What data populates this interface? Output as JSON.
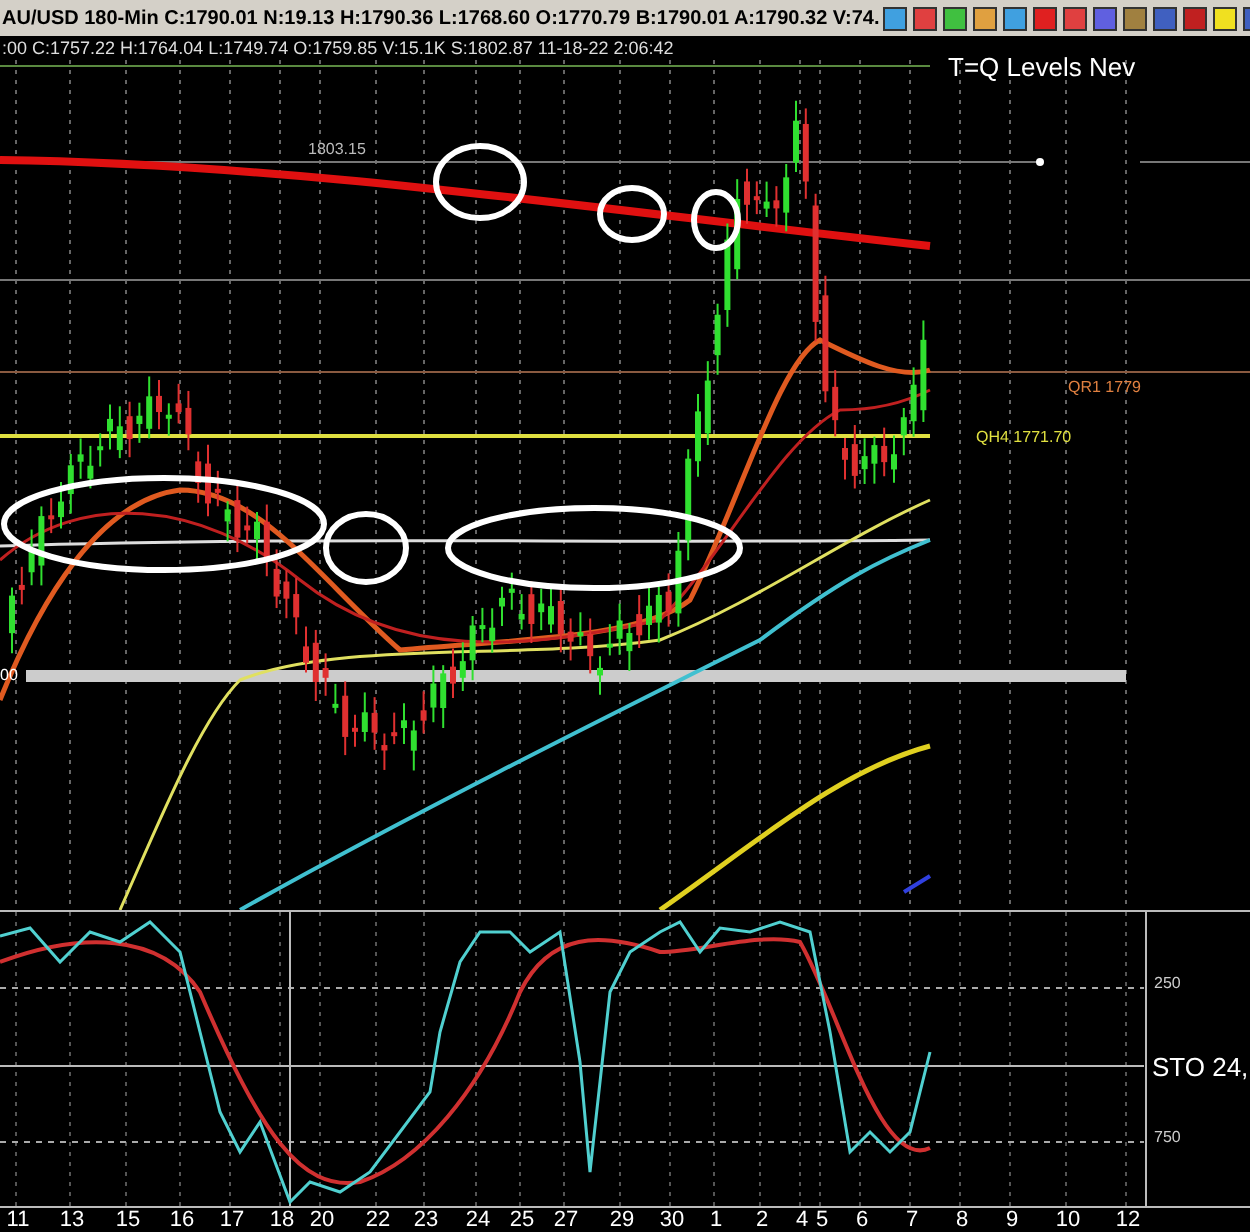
{
  "header": {
    "quote_line": "AU/USD  180-Min  C:1790.01  N:19.13  H:1790.36  L:1768.60  O:1770.79  B:1790.01  A:1790.32  V:74.",
    "bar_line": ":00  C:1757.22  H:1764.04  L:1749.74  O:1759.85  V:15.1K  S:1802.87  11-18-22  2:06:42"
  },
  "chart": {
    "title": "T=Q Levels Nev",
    "level_labels": [
      "1803.15",
      "QR1 1779",
      "QH4 1771.70",
      "00"
    ]
  },
  "stochastic": {
    "indicator_label": "STO  24,",
    "axis_labels": [
      "250",
      "750"
    ]
  },
  "time_axis": {
    "labels": [
      "11",
      "13",
      "15",
      "16",
      "17",
      "18",
      "20",
      "22",
      "23",
      "24",
      "25",
      "27",
      "29",
      "30",
      "1",
      "2",
      "4",
      "5",
      "6",
      "7",
      "8",
      "9",
      "10",
      "12"
    ]
  }
}
